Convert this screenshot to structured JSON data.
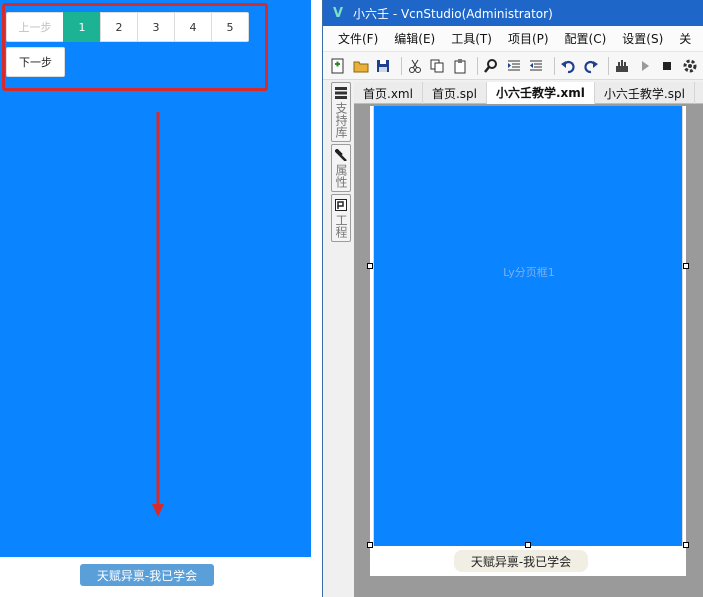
{
  "preview": {
    "pager": {
      "prev_label": "上一步",
      "pages": [
        "1",
        "2",
        "3",
        "4",
        "5"
      ],
      "active_page": "1",
      "next_label": "下一步"
    },
    "footer_badge": "天赋异禀-我已学会",
    "colors": {
      "background": "#0a84ff",
      "active_page": "#1bb394",
      "highlight": "#d62b2b",
      "badge": "#5a9fd8"
    }
  },
  "ide": {
    "title": "小六壬 - VcnStudio(Administrator)",
    "app_icon": "V",
    "menu": [
      "文件(F)",
      "编辑(E)",
      "工具(T)",
      "项目(P)",
      "配置(C)",
      "设置(S)",
      "关"
    ],
    "toolbar_icons": [
      "new-icon",
      "open-icon",
      "save-icon",
      "cut-icon",
      "copy-icon",
      "paste-icon",
      "find-icon",
      "indent-icon",
      "outdent-icon",
      "undo-icon",
      "redo-icon",
      "build-icon",
      "run-icon",
      "stop-icon",
      "settings-icon"
    ],
    "dock_tabs": [
      {
        "icon": "component-library-icon",
        "label": "支持库"
      },
      {
        "icon": "properties-icon",
        "label": "属性"
      },
      {
        "icon": "project-icon",
        "label": "工程"
      }
    ],
    "doc_tabs": [
      {
        "label": "首页.xml",
        "active": false
      },
      {
        "label": "首页.spl",
        "active": false
      },
      {
        "label": "小六壬教学.xml",
        "active": true
      },
      {
        "label": "小六壬教学.spl",
        "active": false
      }
    ],
    "designer": {
      "component_label": "Ly分页框1",
      "footer_badge": "天赋异禀-我已学会"
    }
  }
}
